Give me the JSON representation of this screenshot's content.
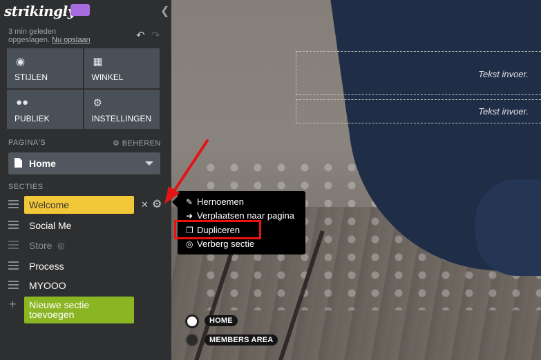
{
  "app": {
    "logo": "strikingly"
  },
  "status": {
    "line1": "3 min geleden",
    "line2": "opgeslagen.",
    "save_link": "Nu opslaan"
  },
  "tiles": [
    {
      "label": "STIJLEN",
      "icon": "palette-icon"
    },
    {
      "label": "WINKEL",
      "icon": "shopping-bag-icon"
    },
    {
      "label": "PUBLIEK",
      "icon": "users-icon"
    },
    {
      "label": "INSTELLINGEN",
      "icon": "gear-icon"
    }
  ],
  "pages": {
    "label": "PAGINA'S",
    "manage": "BEHEREN",
    "current": "Home"
  },
  "sections": {
    "label": "SECTIES",
    "items": [
      {
        "name": "Welcome",
        "state": "active"
      },
      {
        "name": "Social Me",
        "state": "normal"
      },
      {
        "name": "Store",
        "state": "hidden"
      },
      {
        "name": "Process",
        "state": "normal"
      },
      {
        "name": "MYOOO",
        "state": "normal"
      }
    ],
    "new_section": "Nieuwe sectie toevoegen"
  },
  "context_menu": {
    "items": [
      {
        "label": "Hernoemen",
        "icon": "pencil-icon"
      },
      {
        "label": "Verplaatsen naar pagina",
        "icon": "arrow-right-icon"
      },
      {
        "label": "Dupliceren",
        "icon": "copy-icon"
      },
      {
        "label": "Verberg sectie",
        "icon": "eye-slash-icon"
      }
    ],
    "highlighted": "Dupliceren"
  },
  "canvas": {
    "text_placeholder_1": "Tekst invoer.",
    "text_placeholder_2": "Tekst invoer.",
    "nav": [
      {
        "label": "HOME",
        "active": true
      },
      {
        "label": "MEMBERS AREA",
        "active": false
      }
    ]
  },
  "colors": {
    "sidebar_bg": "#2e2f30",
    "tile_bg": "#4a5057",
    "active_section": "#f2c839",
    "new_section": "#8bb523",
    "highlight_border": "#ee1111",
    "logo_badge": "#a96be0"
  }
}
